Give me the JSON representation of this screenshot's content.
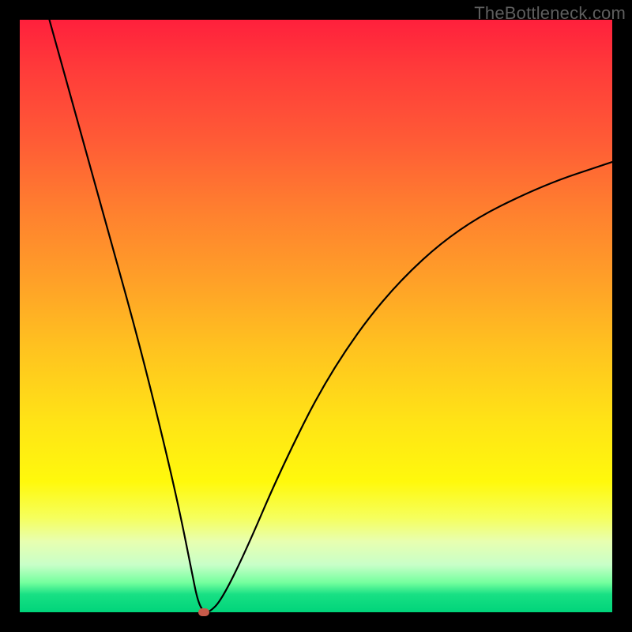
{
  "watermark": "TheBottleneck.com",
  "chart_data": {
    "type": "line",
    "title": "",
    "xlabel": "",
    "ylabel": "",
    "xlim": [
      0,
      100
    ],
    "ylim": [
      0,
      100
    ],
    "grid": false,
    "series": [
      {
        "name": "bottleneck-curve",
        "x": [
          5,
          10,
          15,
          20,
          24,
          27,
          29,
          30,
          31,
          32,
          34,
          38,
          44,
          52,
          62,
          74,
          88,
          100
        ],
        "values": [
          100,
          82,
          64,
          46,
          30,
          17,
          7,
          2,
          0,
          0,
          2,
          10,
          24,
          40,
          54,
          65,
          72,
          76
        ]
      }
    ],
    "marker": {
      "x": 31,
      "y": 0,
      "color": "#c75a4a"
    }
  }
}
